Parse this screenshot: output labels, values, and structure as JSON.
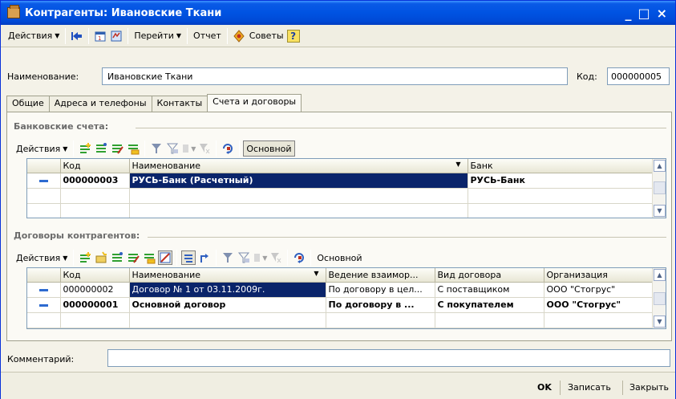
{
  "window": {
    "title": "Контрагенты: Ивановские Ткани",
    "min": "_",
    "max": "□",
    "close": "×"
  },
  "toolbar": {
    "actions": "Действия",
    "goto": "Перейти",
    "report": "Отчет",
    "tips": "Советы",
    "help": "?"
  },
  "form": {
    "name_label": "Наименование:",
    "name_value": "Ивановские Ткани",
    "code_label": "Код:",
    "code_value": "000000005",
    "comment_label": "Комментарий:",
    "comment_value": ""
  },
  "tabs": [
    "Общие",
    "Адреса и телефоны",
    "Контакты",
    "Счета и договоры"
  ],
  "bank": {
    "title": "Банковские счета:",
    "actions": "Действия",
    "main_button": "Основной",
    "columns": [
      "Код",
      "Наименование",
      "Банк"
    ],
    "rows": [
      [
        "000000003",
        "РУСЬ-Банк (Расчетный)",
        "РУСЬ-Банк"
      ]
    ]
  },
  "contracts": {
    "title": "Договоры контрагентов:",
    "actions": "Действия",
    "main_button": "Основной",
    "columns": [
      "Код",
      "Наименование",
      "Ведение взаимор...",
      "Вид договора",
      "Организация"
    ],
    "rows": [
      [
        "000000002",
        "Договор № 1 от 03.11.2009г.",
        "По договору в цел...",
        "С поставщиком",
        "ООО \"Стогрус\""
      ],
      [
        "000000001",
        "Основной договор",
        "По договору в ...",
        "С покупателем",
        "ООО \"Стогрус\""
      ]
    ]
  },
  "footer": {
    "ok": "OK",
    "save": "Записать",
    "close": "Закрыть"
  },
  "colors": {
    "title_bar": "#0053e2",
    "selection": "#0a246a"
  }
}
